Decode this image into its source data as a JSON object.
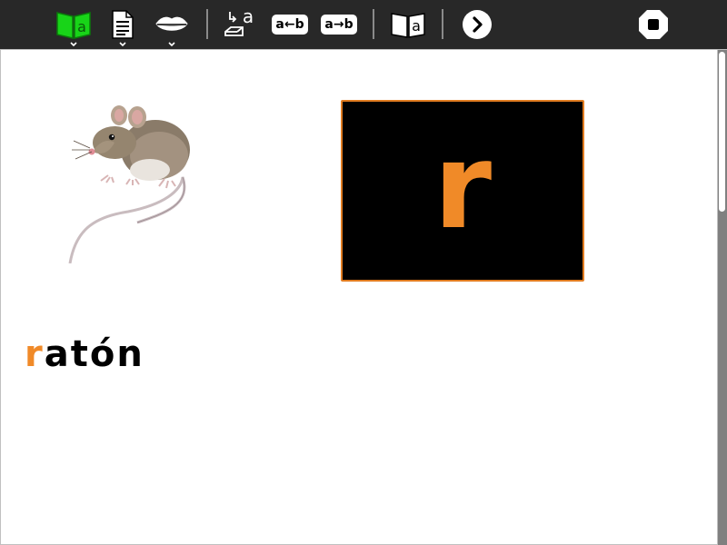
{
  "toolbar": {
    "buttons": [
      {
        "name": "library",
        "icon": "open-book-icon",
        "active": true,
        "has_menu": true
      },
      {
        "name": "document",
        "icon": "document-icon",
        "has_menu": true
      },
      {
        "name": "speak",
        "icon": "lips-icon",
        "has_menu": true
      },
      {
        "name": "uppercase-toggle",
        "icon": "eraser-a-icon"
      },
      {
        "name": "prev-letter",
        "label": "a←b"
      },
      {
        "name": "next-letter",
        "label": "a→b"
      },
      {
        "name": "read",
        "icon": "book-a-icon"
      },
      {
        "name": "next",
        "icon": "chevron-right-icon"
      },
      {
        "name": "stop",
        "icon": "stop-icon"
      }
    ],
    "prev_label": "a←b",
    "next_label": "a→b",
    "icon_a": "a"
  },
  "card": {
    "letter": "r",
    "letter_color": "#f08a28",
    "background": "#000000",
    "border_color": "#e07b20"
  },
  "word": {
    "highlight": "r",
    "rest": "atón",
    "highlight_color": "#f08a28"
  },
  "image": {
    "subject": "mouse"
  },
  "colors": {
    "toolbar_bg": "#282828",
    "active_icon": "#18d418"
  }
}
